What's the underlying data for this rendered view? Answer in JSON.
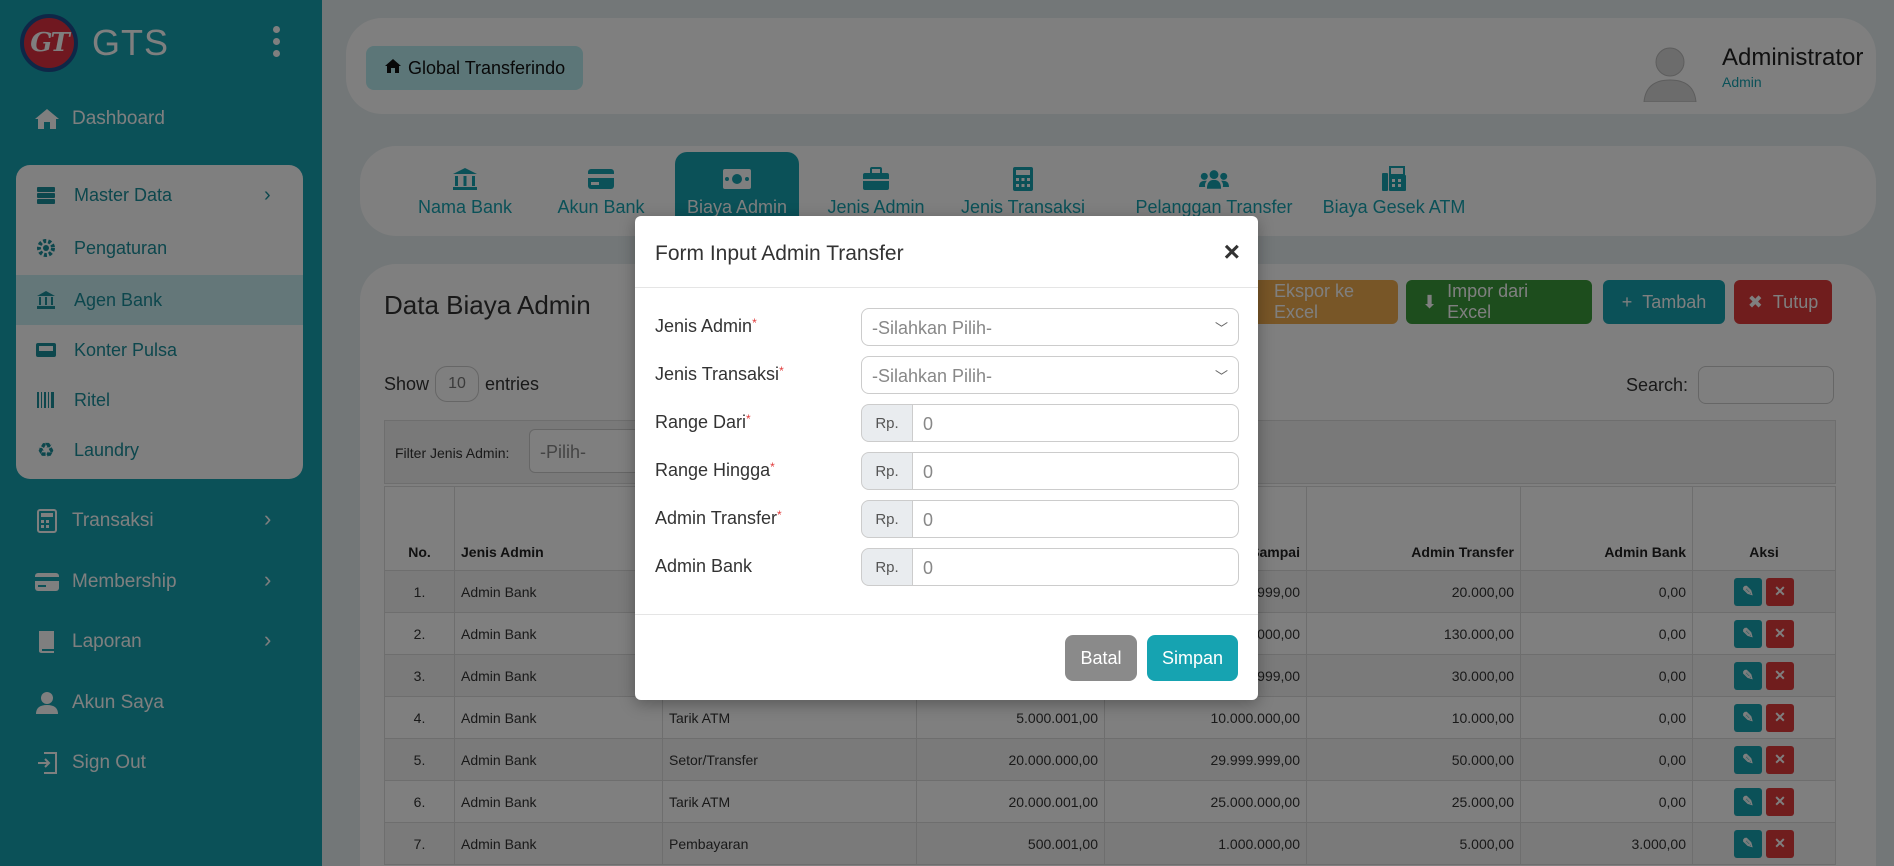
{
  "brand": {
    "logo_text": "GT",
    "name": "GTS"
  },
  "sidebar": {
    "items": [
      {
        "label": "Dashboard",
        "icon": "home-icon"
      },
      {
        "label": "Transaksi",
        "icon": "calculator-icon"
      },
      {
        "label": "Membership",
        "icon": "credit-card-icon"
      },
      {
        "label": "Laporan",
        "icon": "book-icon"
      },
      {
        "label": "Akun Saya",
        "icon": "user-icon"
      },
      {
        "label": "Sign Out",
        "icon": "sign-out-icon"
      }
    ],
    "master": {
      "label": "Master Data",
      "items": [
        {
          "label": "Pengaturan",
          "icon": "gear-icon"
        },
        {
          "label": "Agen Bank",
          "icon": "bank-icon"
        },
        {
          "label": "Konter Pulsa",
          "icon": "cassette-icon"
        },
        {
          "label": "Ritel",
          "icon": "barcode-icon"
        },
        {
          "label": "Laundry",
          "icon": "recycle-icon"
        }
      ]
    }
  },
  "header": {
    "breadcrumb": "Global Transferindo",
    "user_name": "Administrator",
    "user_role": "Admin"
  },
  "tabs": [
    {
      "label": "Nama Bank",
      "icon": "bank-icon"
    },
    {
      "label": "Akun Bank",
      "icon": "credit-card-icon"
    },
    {
      "label": "Biaya Admin",
      "icon": "money-icon"
    },
    {
      "label": "Jenis Admin",
      "icon": "briefcase-icon"
    },
    {
      "label": "Jenis Transaksi",
      "icon": "calculator-icon"
    },
    {
      "label": "Pelanggan Transfer",
      "icon": "users-icon"
    },
    {
      "label": "Biaya Gesek ATM",
      "icon": "fax-icon"
    }
  ],
  "panel": {
    "title": "Data Biaya Admin",
    "buttons": {
      "export": "Ekspor ke Excel",
      "import": "Impor dari Excel",
      "add": "Tambah",
      "close": "Tutup"
    },
    "show_label": "Show",
    "show_value": "10",
    "entries_label": "entries",
    "search_label": "Search:",
    "filter_label": "Filter Jenis Admin:",
    "filter_value": "-Pilih-"
  },
  "table": {
    "headers": [
      "No.",
      "Jenis Admin",
      "",
      "",
      "Sampai",
      "Admin Transfer",
      "Admin Bank",
      "Aksi"
    ],
    "rows": [
      [
        "1.",
        "Admin Bank",
        "",
        "",
        ".999,00",
        "20.000,00",
        "0,00"
      ],
      [
        "2.",
        "Admin Bank",
        "",
        "",
        ".000,00",
        "130.000,00",
        "0,00"
      ],
      [
        "3.",
        "Admin Bank",
        "",
        "",
        ".999,00",
        "30.000,00",
        "0,00"
      ],
      [
        "4.",
        "Admin Bank",
        "Tarik ATM",
        "5.000.001,00",
        "10.000.000,00",
        "10.000,00",
        "0,00"
      ],
      [
        "5.",
        "Admin Bank",
        "Setor/Transfer",
        "20.000.000,00",
        "29.999.999,00",
        "50.000,00",
        "0,00"
      ],
      [
        "6.",
        "Admin Bank",
        "Tarik ATM",
        "20.000.001,00",
        "25.000.000,00",
        "25.000,00",
        "0,00"
      ],
      [
        "7.",
        "Admin Bank",
        "Pembayaran",
        "500.001,00",
        "1.000.000,00",
        "5.000,00",
        "3.000,00"
      ]
    ]
  },
  "modal": {
    "title": "Form Input Admin Transfer",
    "close": "×",
    "fields": {
      "jenis_admin": {
        "label": "Jenis Admin",
        "placeholder": "-Silahkan Pilih-"
      },
      "jenis_transaksi": {
        "label": "Jenis Transaksi",
        "placeholder": "-Silahkan Pilih-"
      },
      "range_dari": {
        "label": "Range Dari",
        "prefix": "Rp.",
        "placeholder": "0"
      },
      "range_hingga": {
        "label": "Range Hingga",
        "prefix": "Rp.",
        "placeholder": "0"
      },
      "admin_transfer": {
        "label": "Admin Transfer",
        "prefix": "Rp.",
        "placeholder": "0"
      },
      "admin_bank": {
        "label": "Admin Bank",
        "prefix": "Rp.",
        "placeholder": "0"
      }
    },
    "required_mark": "*",
    "cancel": "Batal",
    "save": "Simpan"
  }
}
